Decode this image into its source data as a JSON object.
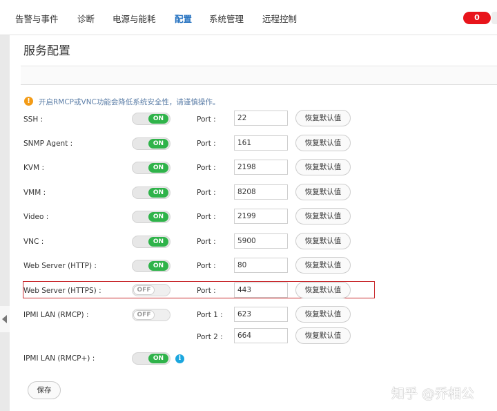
{
  "nav": {
    "items": [
      "告警与事件",
      "诊断",
      "电源与能耗",
      "配置",
      "系统管理",
      "远程控制"
    ],
    "active": "配置",
    "alarm_count": "0"
  },
  "page": {
    "title": "服务配置",
    "warning": "开启RMCP或VNC功能会降低系统安全性，请谨慎操作。",
    "warning_icon": "!",
    "port_label": "Port :",
    "port1_label": "Port 1 :",
    "port2_label": "Port 2 :",
    "reset_label": "恢复默认值",
    "save_label": "保存",
    "info_icon": "i"
  },
  "services": [
    {
      "label": "SSH :",
      "state": "ON",
      "port": "22"
    },
    {
      "label": "SNMP Agent :",
      "state": "ON",
      "port": "161"
    },
    {
      "label": "KVM :",
      "state": "ON",
      "port": "2198"
    },
    {
      "label": "VMM :",
      "state": "ON",
      "port": "8208"
    },
    {
      "label": "Video :",
      "state": "ON",
      "port": "2199"
    },
    {
      "label": "VNC :",
      "state": "ON",
      "port": "5900"
    },
    {
      "label": "Web Server (HTTP) :",
      "state": "ON",
      "port": "80"
    },
    {
      "label": "Web Server (HTTPS) :",
      "state": "OFF",
      "port": "443"
    },
    {
      "label": "IPMI LAN (RMCP) :",
      "state": "OFF",
      "port1": "623",
      "port2": "664"
    },
    {
      "label": "IPMI LAN (RMCP+) :",
      "state": "ON"
    }
  ],
  "watermark": "知乎 @乔相公",
  "colors": {
    "accent": "#2b76c2",
    "on": "#2fb34a",
    "alarm": "#e8141b",
    "highlight": "#c8282c",
    "warning": "#f39b16",
    "info": "#1ba6de"
  }
}
